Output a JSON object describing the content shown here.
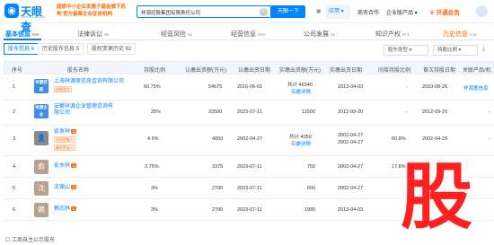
{
  "header": {
    "logo_text": "天眼查",
    "logo_sub": "TianYanCha.com",
    "slogan": "国家中小企业发展子基金旗下机构 官方备案企业征信机构",
    "search_value": "祥源控股集团有限责任公司",
    "search_button": "天眼一下",
    "nav": {
      "apps": "应用",
      "business": "商务合作",
      "enterprise": "企业版产品",
      "vip": "开通会员"
    }
  },
  "tabs": [
    {
      "label": "基本信息",
      "count": "606"
    },
    {
      "label": "法律诉讼",
      "count": "99"
    },
    {
      "label": "经营风险",
      "count": "62"
    },
    {
      "label": "经营信息",
      "count": "999+"
    },
    {
      "label": "公司发展",
      "count": "32"
    },
    {
      "label": "知识产权",
      "count": "974"
    },
    {
      "label": "历史信息",
      "count": "241"
    }
  ],
  "subtabs": [
    {
      "label": "股东信息",
      "count": "6"
    },
    {
      "label": "历史股东信息",
      "count": "5"
    },
    {
      "label": "股权变更历史",
      "count": "62"
    }
  ],
  "filters": {
    "ratio": "股东类型",
    "amount": "持股比例"
  },
  "columns": [
    "序号",
    "股东名称",
    "持股比例",
    "认缴出资额(万元)",
    "认缴出资日期",
    "实缴出资额(万元)",
    "实缴出资日期",
    "间接持股比例",
    "首次持股日期",
    "关联产品/机构"
  ],
  "rows": [
    {
      "no": "1",
      "seal": "祥源控股",
      "seal_color": "#3e8be8",
      "name": "上海祥源原信息咨询有限公司",
      "tag": "控股股东",
      "ratio": "60.75%",
      "sub_amount": "54675",
      "sub_date": "2016-06-01",
      "paid_amount": "共计 46340",
      "paid_link": "实缴详情",
      "paid_date": "2013-04-03",
      "indirect": "-",
      "first_date": "2010-08-26",
      "related": "祥源惠信息"
    },
    {
      "no": "2",
      "seal": "祥源企业",
      "seal_color": "#3e8be8",
      "name": "安徽祥源企业管理咨询有限公司",
      "tag": "",
      "ratio": "25%",
      "sub_amount": "22500",
      "sub_date": "2023-07-11",
      "paid_amount": "11500",
      "paid_link": "",
      "paid_date": "2012-09-20",
      "indirect": "-",
      "first_date": "2012-09-20",
      "related": "-"
    },
    {
      "no": "3",
      "seal": "",
      "seal_color": "#888888",
      "name": "俞发祥",
      "badge": "13",
      "tag": "实际控制人",
      "tag2": "最终受益人",
      "ratio": "4.5%",
      "sub_amount": "4050",
      "sub_date": "2002-04-27",
      "paid_amount": "共计 4050",
      "paid_link": "实缴详情",
      "paid_date": "2002-04-27",
      "indirect": "60.8%",
      "first_date": "2002-04-29",
      "related": "-"
    },
    {
      "no": "4",
      "face": "俞",
      "face_color": "#b9a28d",
      "name": "俞水祥",
      "badge": "11",
      "ratio": "3.75%",
      "sub_amount": "3375",
      "sub_date": "2023-07-11",
      "paid_amount": "750",
      "paid_date": "2002-04-27",
      "indirect": "17.8%",
      "first_date": "",
      "related": ""
    },
    {
      "no": "5",
      "face": "沈",
      "face_color": "#b9a28d",
      "name": "沈保山",
      "badge": "11",
      "ratio": "3%",
      "sub_amount": "2700",
      "sub_date": "2023-07-11",
      "paid_amount": "600",
      "paid_date": "2002-04-27",
      "indirect": "",
      "first_date": "",
      "related": ""
    },
    {
      "no": "6",
      "face": "赖",
      "face_color": "#b9a28d",
      "name": "赖志林",
      "badge": "11",
      "ratio": "3%",
      "sub_amount": "2700",
      "sub_date": "2023-07-11",
      "paid_amount": "1980",
      "paid_date": "2013-04-03",
      "indirect": "",
      "first_date": "",
      "related": ""
    }
  ],
  "footer": "工商自主公示股东",
  "watermark": "股"
}
